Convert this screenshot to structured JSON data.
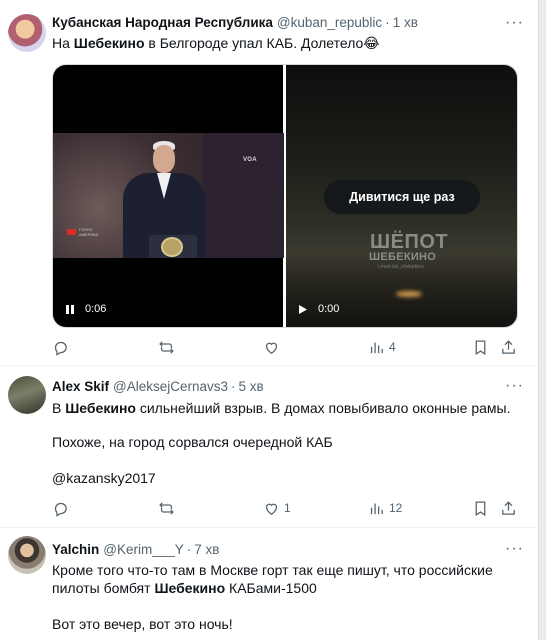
{
  "tweets": [
    {
      "name": "Кубанская Народная Республика",
      "handle": "@kuban_republic",
      "time": "1 хв",
      "text_pre": "На ",
      "text_bold": "Шебекино",
      "text_post": " в Белгороде упал КАБ. Долетело😂",
      "videos": [
        {
          "time": "0:06",
          "channel": "VOA",
          "ticker": "ГОЛОС АМЕРИКИ"
        },
        {
          "time": "0:00",
          "overlay": "Дивитися ще раз",
          "watermark_main": "ШЁПОТ",
          "watermark_sub": "ШЕБЕКИНО",
          "watermark_handle": "t.me/club_shebekino"
        }
      ],
      "views": "4"
    },
    {
      "name": "Alex Skif",
      "handle": "@AleksejCernavs3",
      "time": "5 хв",
      "line1_pre": "В ",
      "line1_bold": "Шебекино",
      "line1_post": " сильнейший взрыв. В домах повыбивало оконные рамы.",
      "line2": "Похоже, на город сорвался очередной КАБ",
      "line3": "@kazansky2017",
      "likes": "1",
      "views": "12"
    },
    {
      "name": "Yalchin",
      "handle": "@Kerim___Y",
      "time": "7 хв",
      "line1": "Кроме того что-то там в Москве горт так еще пишут, что российские",
      "line2_pre": "пилоты бомбят ",
      "line2_bold": "Шебекино",
      "line2_post": " КАБами-1500",
      "line3": "Вот это вечер, вот это ночь!"
    }
  ],
  "icons": [
    "reply-icon",
    "retweet-icon",
    "like-icon",
    "views-icon",
    "bookmark-icon",
    "share-icon",
    "more-icon",
    "pause-icon",
    "play-icon"
  ],
  "colors": {
    "secondary_text": "#536471",
    "primary_text": "#0f1419",
    "divider": "#eff3f4"
  }
}
